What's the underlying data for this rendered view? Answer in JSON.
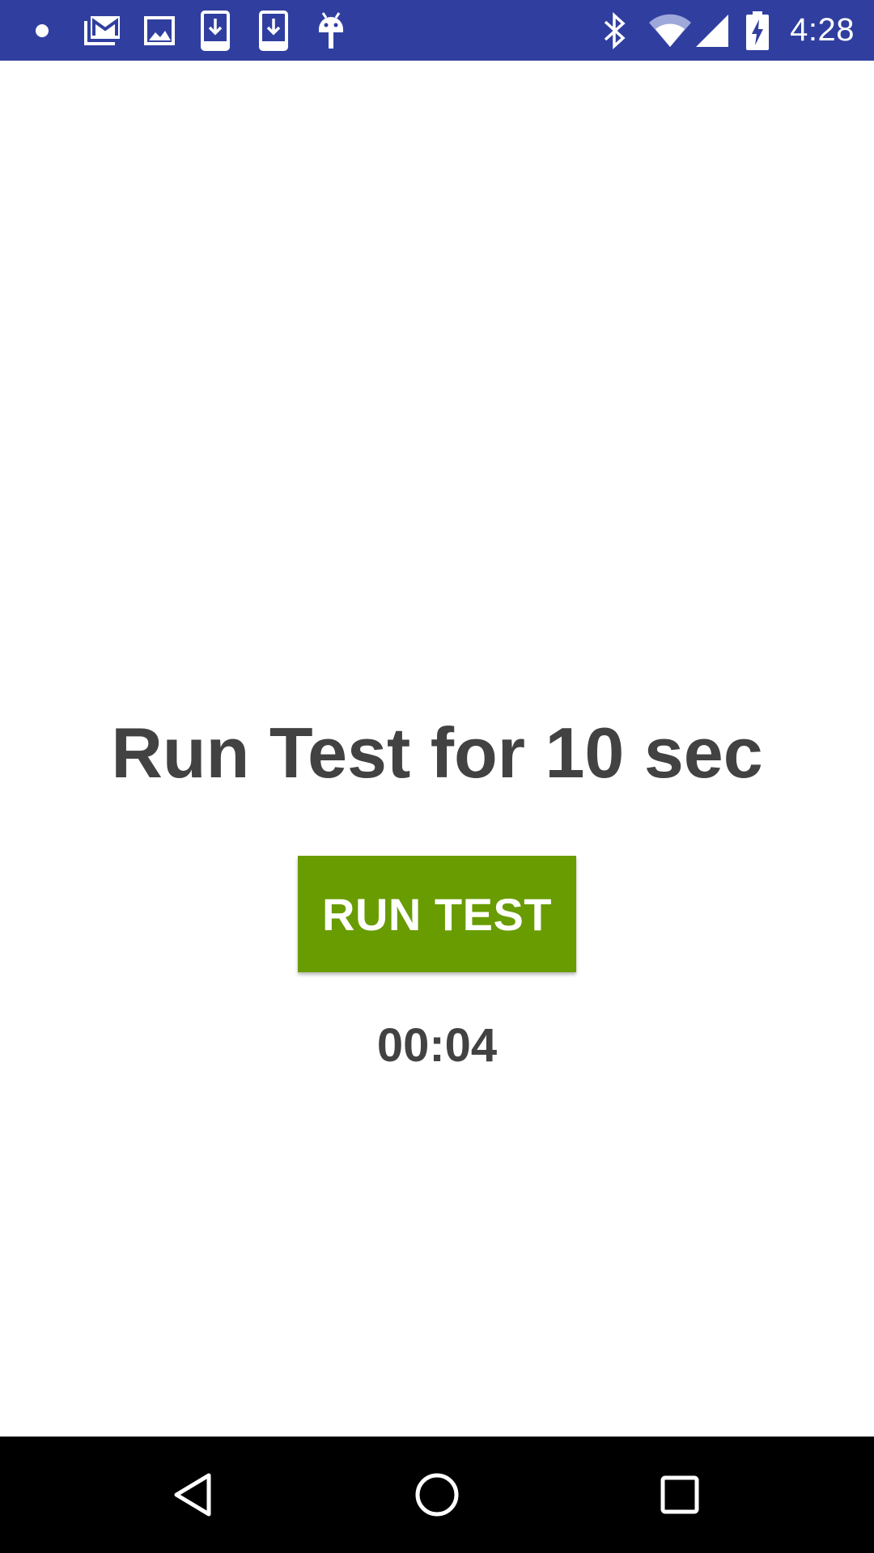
{
  "status_bar": {
    "time": "4:28",
    "background": "#303f9f",
    "notification_icons": [
      "notification-dot-icon",
      "gmail-icon",
      "gallery-icon",
      "download-icon",
      "download-icon",
      "android-icon"
    ],
    "system_icons": [
      "bluetooth-icon",
      "wifi-icon",
      "cell-signal-icon",
      "battery-charging-icon"
    ]
  },
  "main": {
    "title": "Run Test for 10 sec",
    "run_button_label": "RUN TEST",
    "timer": "00:04",
    "accent_color": "#689c00",
    "text_color": "#424242"
  },
  "nav_bar": {
    "buttons": [
      "back-icon",
      "home-icon",
      "recents-icon"
    ]
  }
}
